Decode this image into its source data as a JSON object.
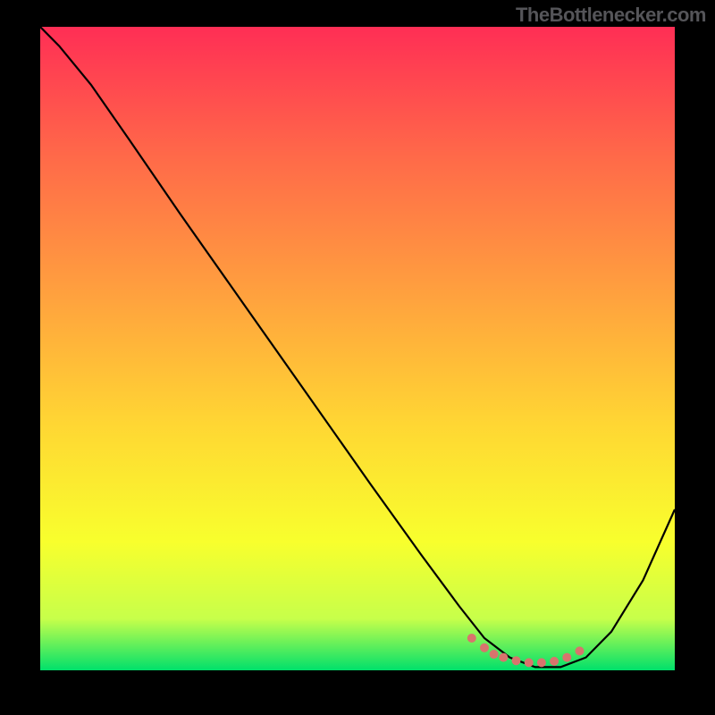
{
  "watermark": "TheBottlenecker.com",
  "chart_data": {
    "type": "line",
    "title": "",
    "xlabel": "",
    "ylabel": "",
    "xlim": [
      0,
      100
    ],
    "ylim": [
      0,
      100
    ],
    "background_gradient": {
      "stops": [
        {
          "offset": 0.0,
          "color": "#ff2e55"
        },
        {
          "offset": 0.2,
          "color": "#ff6949"
        },
        {
          "offset": 0.42,
          "color": "#ffa23e"
        },
        {
          "offset": 0.62,
          "color": "#ffd733"
        },
        {
          "offset": 0.8,
          "color": "#f8ff2d"
        },
        {
          "offset": 0.92,
          "color": "#c7ff4a"
        },
        {
          "offset": 1.0,
          "color": "#00e06b"
        }
      ]
    },
    "series": [
      {
        "name": "curve",
        "color": "#000000",
        "x": [
          0.0,
          3.0,
          8.0,
          14.0,
          22.0,
          32.0,
          42.0,
          52.0,
          60.0,
          66.0,
          70.0,
          74.0,
          78.0,
          82.0,
          86.0,
          90.0,
          95.0,
          100.0
        ],
        "y": [
          100.0,
          97.0,
          91.0,
          82.5,
          71.0,
          57.0,
          43.0,
          29.0,
          18.0,
          10.0,
          5.0,
          2.0,
          0.5,
          0.5,
          2.0,
          6.0,
          14.0,
          25.0
        ]
      },
      {
        "name": "highlight-dots",
        "color": "#d8746d",
        "type": "scatter",
        "x": [
          68.0,
          70.0,
          71.5,
          73.0,
          75.0,
          77.0,
          79.0,
          81.0,
          83.0,
          85.0
        ],
        "y": [
          5.0,
          3.5,
          2.5,
          2.0,
          1.5,
          1.2,
          1.2,
          1.4,
          2.0,
          3.0
        ]
      }
    ]
  }
}
